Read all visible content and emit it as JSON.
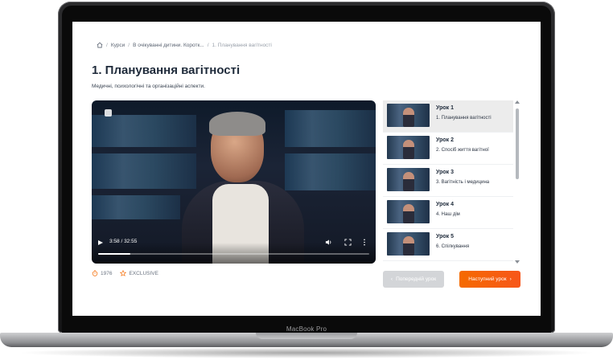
{
  "device": {
    "label": "MacBook Pro"
  },
  "breadcrumb": {
    "home_icon": "home-icon",
    "items": [
      "Курси",
      "В очікуванні дитини. Коротк...",
      "1. Планування вагітності"
    ]
  },
  "page": {
    "title": "1. Планування вагітності",
    "subtitle": "Медичні, психологічні та організаційні аспекти."
  },
  "video": {
    "current_time": "3:58",
    "duration": "32:55",
    "time_display": "3:58 / 32:55",
    "progress_fraction": 0.12
  },
  "stats": {
    "views": "1976",
    "badge": "EXCLUSIVE",
    "accent_color": "#f56a00"
  },
  "lessons": [
    {
      "label": "Урок 1",
      "title": "1. Планування вагітності",
      "active": true
    },
    {
      "label": "Урок 2",
      "title": "2. Спосіб життя вагітної",
      "active": false
    },
    {
      "label": "Урок 3",
      "title": "3. Вагітність і медицина",
      "active": false
    },
    {
      "label": "Урок 4",
      "title": "4. Наш дім",
      "active": false
    },
    {
      "label": "Урок 5",
      "title": "6. Спілкування",
      "active": false
    }
  ],
  "nav": {
    "prev_label": "Попередній урок",
    "next_label": "Наступний урок",
    "prev_color": "#d3d5d8",
    "next_color": "#f56a00"
  }
}
